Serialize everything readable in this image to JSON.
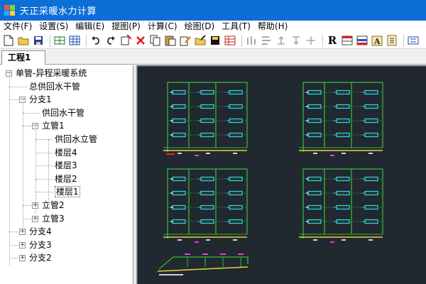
{
  "window": {
    "title": "天正采暖水力计算"
  },
  "menu": {
    "items": [
      {
        "label": "文件(F)",
        "name": "menu-file"
      },
      {
        "label": "设置(S)",
        "name": "menu-settings"
      },
      {
        "label": "编辑(E)",
        "name": "menu-edit"
      },
      {
        "label": "提图(P)",
        "name": "menu-extract"
      },
      {
        "label": "计算(C)",
        "name": "menu-calculate"
      },
      {
        "label": "绘图(D)",
        "name": "menu-draw"
      },
      {
        "label": "工具(T)",
        "name": "menu-tools"
      },
      {
        "label": "帮助(H)",
        "name": "menu-help"
      }
    ]
  },
  "toolbar": {
    "icons": [
      "new-file-icon",
      "open-folder-icon",
      "save-icon",
      "pipe-table-icon",
      "grid-table-icon",
      "undo-icon",
      "redo-icon",
      "add-node-icon",
      "delete-icon",
      "copy-icon",
      "paste-icon",
      "edit-icon",
      "folder-edit-icon",
      "save-disk-icon",
      "calc-table-icon",
      "radiator-icon",
      "bar-up-icon",
      "bar-left-icon",
      "pipe-up-icon",
      "pipe-down-icon",
      "R-icon",
      "table-red-icon",
      "table-blue-icon",
      "text-font-icon",
      "book-icon",
      "more-icon"
    ],
    "r_label": "R"
  },
  "tabs": [
    {
      "label": "工程1"
    }
  ],
  "tree": {
    "nodes": [
      {
        "label": "单管-异程采暖系统",
        "level": 0,
        "expander": "−"
      },
      {
        "label": "总供回水干管",
        "level": 1,
        "expander": ""
      },
      {
        "label": "分支1",
        "level": 1,
        "expander": "−"
      },
      {
        "label": "供回水干管",
        "level": 2,
        "expander": ""
      },
      {
        "label": "立管1",
        "level": 2,
        "expander": "−"
      },
      {
        "label": "供回水立管",
        "level": 3,
        "expander": ""
      },
      {
        "label": "楼层4",
        "level": 3,
        "expander": ""
      },
      {
        "label": "楼层3",
        "level": 3,
        "expander": ""
      },
      {
        "label": "楼层2",
        "level": 3,
        "expander": ""
      },
      {
        "label": "楼层1",
        "level": 3,
        "expander": "",
        "selected": true
      },
      {
        "label": "立管2",
        "level": 2,
        "expander": "+"
      },
      {
        "label": "立管3",
        "level": 2,
        "expander": "+"
      },
      {
        "label": "分支4",
        "level": 1,
        "expander": "+"
      },
      {
        "label": "分支3",
        "level": 1,
        "expander": "+"
      },
      {
        "label": "分支2",
        "level": 1,
        "expander": "+"
      }
    ]
  },
  "colors": {
    "titlebar": "#0c6fd6",
    "canvas_bg": "#212830",
    "pipe_green": "#3adf3a",
    "radiator_cyan": "#35d7e6",
    "base_yellow": "#e6d43a",
    "label_magenta": "#e040e0",
    "label_red": "#e03030"
  }
}
